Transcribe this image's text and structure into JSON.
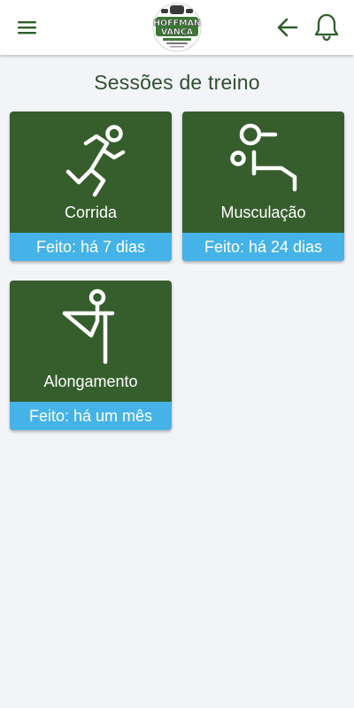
{
  "header": {
    "logo_text": [
      "HOFFMAN",
      "VANÇA"
    ],
    "icons": {
      "menu": "hamburger-menu-icon",
      "back": "arrow-left-icon",
      "notifications": "bell-icon"
    }
  },
  "main": {
    "title": "Sessões de treino",
    "sessions": [
      {
        "label": "Corrida",
        "status": "Feito: há 7 dias",
        "icon": "running-person-icon"
      },
      {
        "label": "Musculação",
        "status": "Feito: há 24 dias",
        "icon": "weightlifting-icon"
      },
      {
        "label": "Alongamento",
        "status": "Feito: há um mês",
        "icon": "stretching-icon"
      }
    ]
  },
  "colors": {
    "accent_green": "#365e2c",
    "status_blue": "#45b3e7",
    "header_icon_green": "#2e5e2a",
    "background": "#f3f4f8"
  }
}
